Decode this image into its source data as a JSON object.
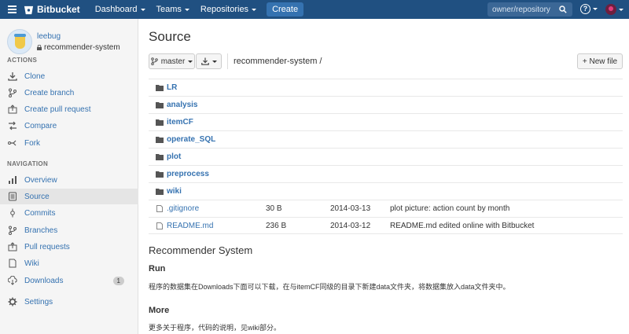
{
  "topbar": {
    "brand": "Bitbucket",
    "nav": [
      "Dashboard",
      "Teams",
      "Repositories"
    ],
    "create_label": "Create",
    "search_placeholder": "owner/repository",
    "help_label": "?"
  },
  "repo": {
    "owner": "leebug",
    "name": "recommender-system"
  },
  "sidebar": {
    "actions_title": "ACTIONS",
    "actions": [
      {
        "label": "Clone",
        "icon": "clone-icon"
      },
      {
        "label": "Create branch",
        "icon": "branch-icon"
      },
      {
        "label": "Create pull request",
        "icon": "pull-request-icon"
      },
      {
        "label": "Compare",
        "icon": "compare-icon"
      },
      {
        "label": "Fork",
        "icon": "fork-icon"
      }
    ],
    "navigation_title": "NAVIGATION",
    "navigation": [
      {
        "label": "Overview",
        "icon": "overview-icon"
      },
      {
        "label": "Source",
        "icon": "source-icon",
        "active": true
      },
      {
        "label": "Commits",
        "icon": "commits-icon"
      },
      {
        "label": "Branches",
        "icon": "branches-icon"
      },
      {
        "label": "Pull requests",
        "icon": "pull-requests-icon"
      },
      {
        "label": "Wiki",
        "icon": "wiki-icon"
      },
      {
        "label": "Downloads",
        "icon": "downloads-icon",
        "badge": "1"
      },
      {
        "label": "Settings",
        "icon": "settings-icon"
      }
    ]
  },
  "main": {
    "title": "Source",
    "branch": "master",
    "breadcrumb": "recommender-system /",
    "new_file_label": "+ New file",
    "files": [
      {
        "name": "LR",
        "type": "dir",
        "size": "",
        "date": "",
        "message": ""
      },
      {
        "name": "analysis",
        "type": "dir",
        "size": "",
        "date": "",
        "message": ""
      },
      {
        "name": "itemCF",
        "type": "dir",
        "size": "",
        "date": "",
        "message": ""
      },
      {
        "name": "operate_SQL",
        "type": "dir",
        "size": "",
        "date": "",
        "message": ""
      },
      {
        "name": "plot",
        "type": "dir",
        "size": "",
        "date": "",
        "message": ""
      },
      {
        "name": "preprocess",
        "type": "dir",
        "size": "",
        "date": "",
        "message": ""
      },
      {
        "name": "wiki",
        "type": "dir",
        "size": "",
        "date": "",
        "message": ""
      },
      {
        "name": ".gitignore",
        "type": "file",
        "size": "30 B",
        "date": "2014-03-13",
        "message": "plot picture: action count by month"
      },
      {
        "name": "README.md",
        "type": "file",
        "size": "236 B",
        "date": "2014-03-12",
        "message": "README.md edited online with Bitbucket"
      }
    ]
  },
  "readme": {
    "title": "Recommender System",
    "run_heading": "Run",
    "run_text": "程序的数据集在Downloads下面可以下载，在与itemCF同级的目录下新建data文件夹，将数据集放入data文件夹中。",
    "more_heading": "More",
    "more_text": "更多关于程序，代码的说明，见wiki部分。"
  },
  "colors": {
    "topbar": "#205081",
    "link": "#3572b0",
    "sidebar_bg": "#f5f5f5"
  }
}
